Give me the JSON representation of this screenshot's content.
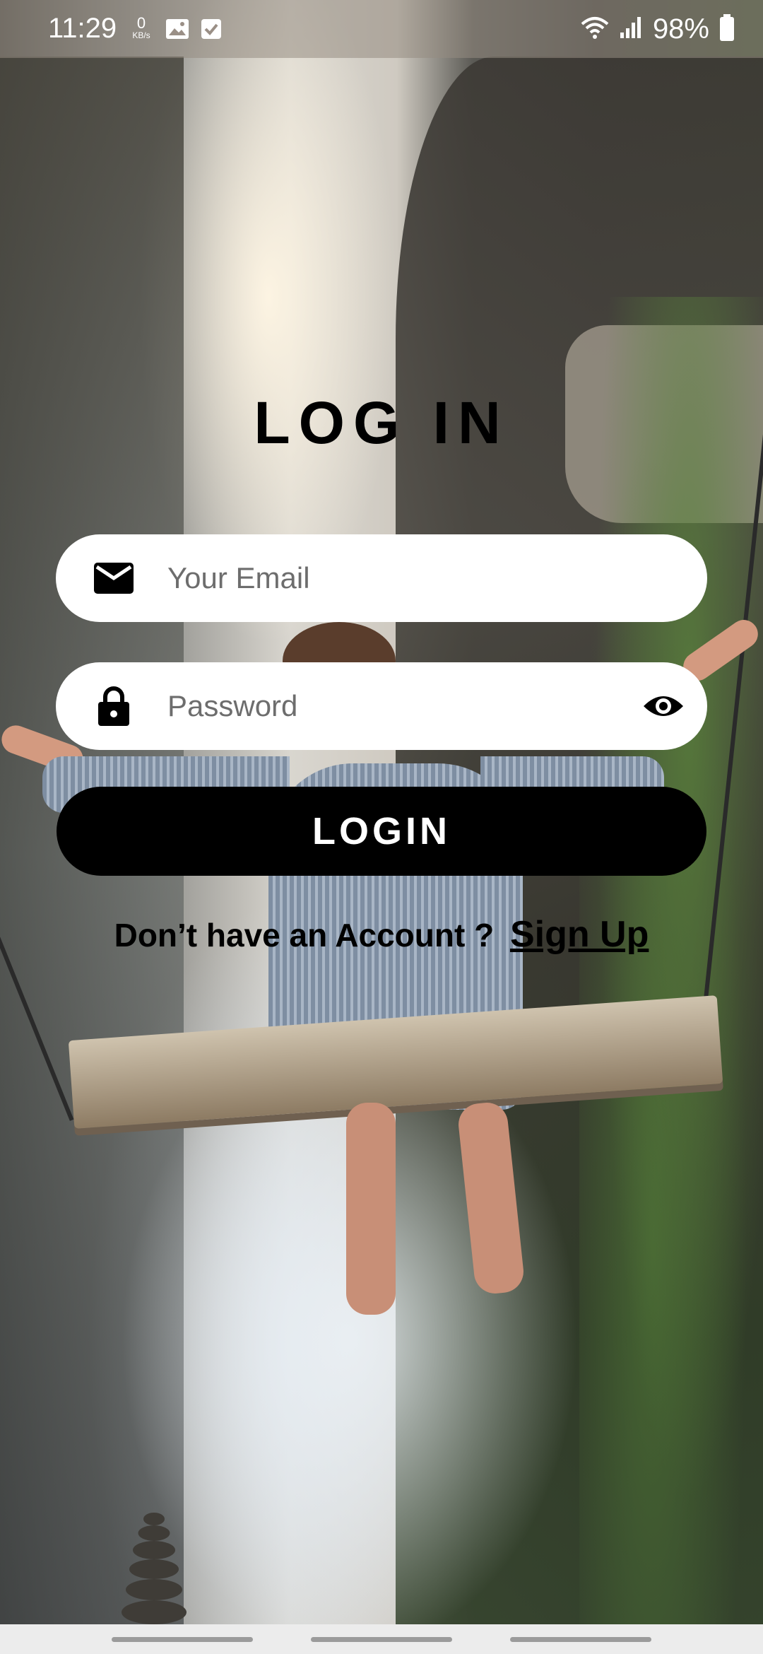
{
  "status_bar": {
    "time": "11:29",
    "net_speed_value": "0",
    "net_speed_unit": "KB/s",
    "battery_percent": "98%",
    "icons": [
      "image-icon",
      "check-box-icon",
      "wifi-icon",
      "signal-icon",
      "battery-icon"
    ]
  },
  "login": {
    "title": "LOG IN",
    "email": {
      "placeholder": "Your Email",
      "value": "",
      "icon": "mail-icon"
    },
    "password": {
      "placeholder": "Password",
      "value": "",
      "icon": "lock-icon",
      "toggle_icon": "eye-icon"
    },
    "login_button": "LOGIN",
    "signup_prompt": "Don’t have an Account ?",
    "signup_link": "Sign Up"
  },
  "colors": {
    "field_bg": "#ffffff",
    "button_bg": "#000000",
    "button_text": "#ffffff",
    "text": "#000000"
  }
}
